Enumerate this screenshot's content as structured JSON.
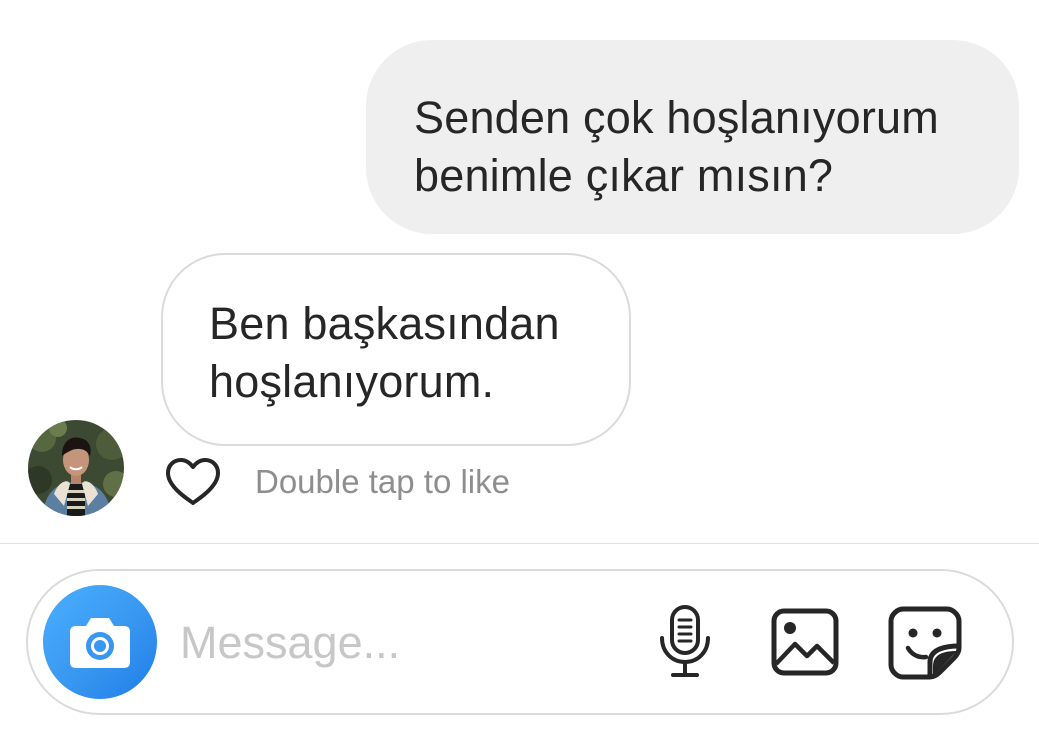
{
  "messages": {
    "sent": {
      "lines": [
        "Senden çok hoşlanıyorum",
        "benimle çıkar mısın?"
      ]
    },
    "received": {
      "lines": [
        "Ben başkasından",
        "hoşlanıyorum."
      ]
    }
  },
  "reaction": {
    "icon": "heart-outline-icon",
    "hint": "Double tap to like"
  },
  "composer": {
    "placeholder": "Message...",
    "icons": {
      "camera": "camera-icon",
      "mic": "microphone-icon",
      "gallery": "gallery-icon",
      "sticker": "sticker-icon"
    }
  },
  "colors": {
    "sent_bubble": "#efefef",
    "received_border": "#dbdbdb",
    "accent": "#3897f0",
    "muted_text": "#8e8e8e",
    "placeholder": "#c7c7c7"
  }
}
